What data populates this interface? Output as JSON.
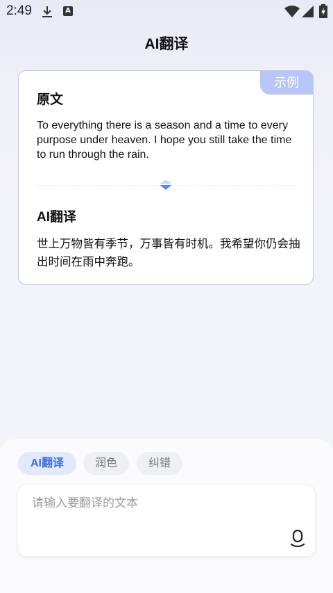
{
  "status_bar": {
    "time": "2:49",
    "icons": [
      "download-icon",
      "a-icon",
      "wifi-icon",
      "signal-icon",
      "battery-icon"
    ],
    "a_icon_letter": "A"
  },
  "header": {
    "title": "AI翻译"
  },
  "example_card": {
    "badge": "示例",
    "source_title": "原文",
    "source_text": "To everything there is a season and a time to every purpose under heaven. I hope you still take the time to run through the rain.",
    "ai_title": "AI翻译",
    "ai_text": "世上万物皆有季节，万事皆有时机。我希望你仍会抽出时间在雨中奔跑。",
    "divider_icon": "chevron-down-icon"
  },
  "bottom": {
    "tabs": [
      {
        "label": "AI翻译",
        "active": true
      },
      {
        "label": "润色",
        "active": false
      },
      {
        "label": "纠错",
        "active": false
      }
    ],
    "input": {
      "placeholder": "请输入要翻译的文本",
      "value": ""
    },
    "mic_icon": "mic-icon"
  },
  "colors": {
    "accent": "#3d6be0",
    "badge": "#b7c6f7",
    "card_border": "#c2c6ec",
    "background": "#f3f4f9"
  }
}
